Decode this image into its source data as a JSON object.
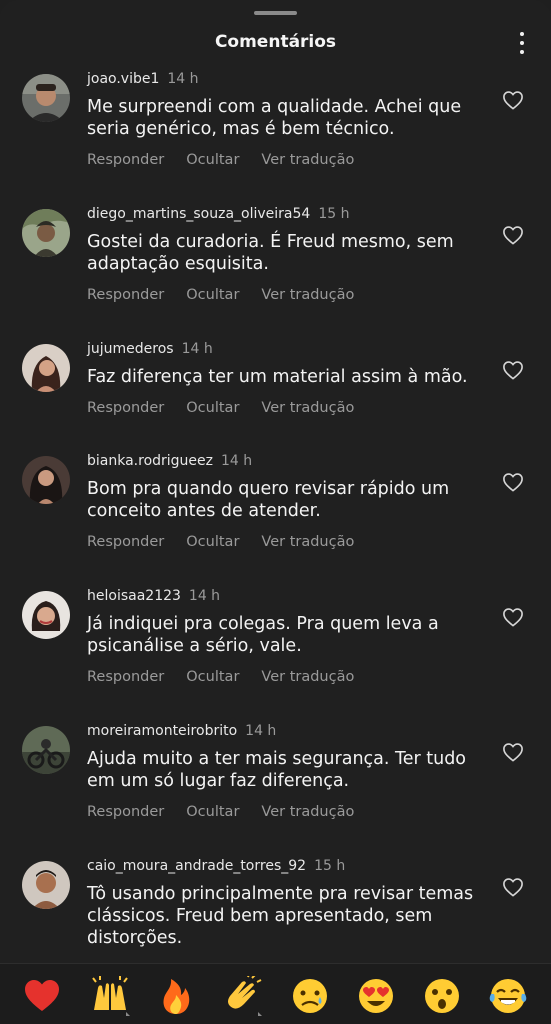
{
  "header": {
    "title": "Comentários"
  },
  "comments": [
    {
      "user": "joao.vibe1",
      "time": "14 h",
      "text": "Me surpreendi com a qualidade. Achei que seria genérico, mas é bem técnico.",
      "actions": [
        "Responder",
        "Ocultar",
        "Ver tradução"
      ]
    },
    {
      "user": "diego_martins_souza_oliveira54",
      "time": "15 h",
      "text": "Gostei da curadoria. É Freud mesmo, sem adaptação esquisita.",
      "actions": [
        "Responder",
        "Ocultar",
        "Ver tradução"
      ]
    },
    {
      "user": "jujumederos",
      "time": "14 h",
      "text": "Faz diferença ter um material assim à mão.",
      "actions": [
        "Responder",
        "Ocultar",
        "Ver tradução"
      ]
    },
    {
      "user": "bianka.rodrigueez",
      "time": "14 h",
      "text": "Bom pra quando quero revisar rápido um conceito antes de atender.",
      "actions": [
        "Responder",
        "Ocultar",
        "Ver tradução"
      ]
    },
    {
      "user": "heloisaa2123",
      "time": "14 h",
      "text": "Já indiquei pra colegas. Pra quem leva a psicanálise a sério, vale.",
      "actions": [
        "Responder",
        "Ocultar",
        "Ver tradução"
      ]
    },
    {
      "user": "moreiramonteirobrito",
      "time": "14 h",
      "text": "Ajuda muito a ter mais segurança. Ter tudo em um só lugar faz diferença.",
      "actions": [
        "Responder",
        "Ocultar",
        "Ver tradução"
      ]
    },
    {
      "user": "caio_moura_andrade_torres_92",
      "time": "15 h",
      "text": "Tô usando principalmente pra revisar temas clássicos. Freud bem apresentado, sem distorções.",
      "actions": []
    }
  ],
  "emoji_bar": [
    "red-heart",
    "raising-hands",
    "fire",
    "clapping-hands",
    "crying-face",
    "heart-eyes-face",
    "astonished-face",
    "tears-of-joy-face"
  ]
}
